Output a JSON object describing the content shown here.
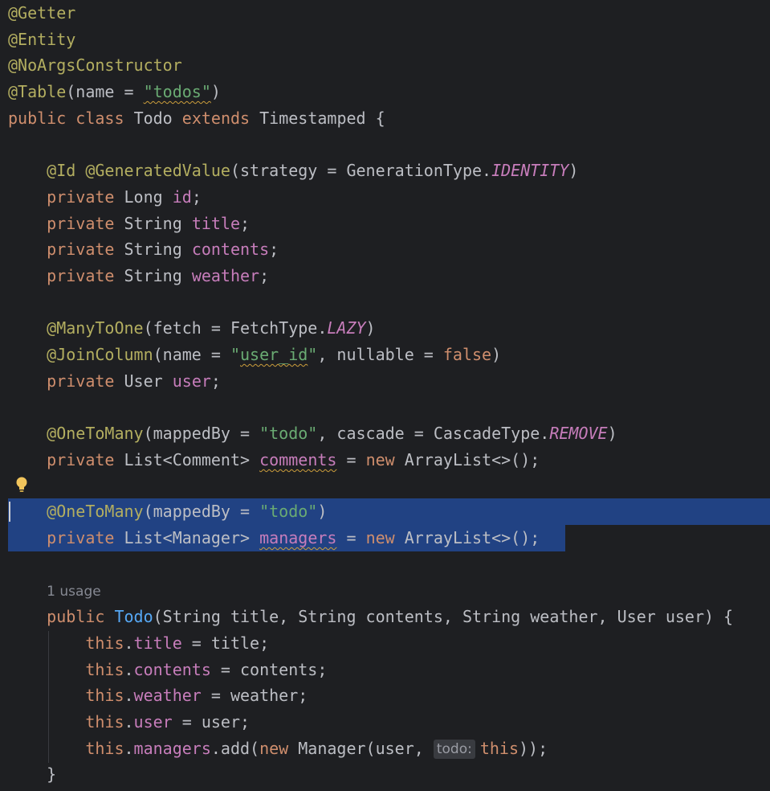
{
  "editor": {
    "file_language": "Java",
    "colors": {
      "background": "#1e1f22",
      "selection": "#214283",
      "keyword": "#cf8e6d",
      "annotation": "#b3ae60",
      "string": "#6aab73",
      "field": "#c77dbb",
      "method_declaration": "#56a8f5",
      "default_text": "#bcbec4",
      "typo_underline": "#cc9e3c"
    },
    "icons": {
      "gutter_hint": "lightbulb-icon"
    },
    "tokens": {
      "getter": "@Getter",
      "entity": "@Entity",
      "noargs": "@NoArgsConstructor",
      "table": "@Table",
      "name_eq": "(name = ",
      "todos_str": "\"todos\"",
      "close_paren": ")",
      "public": "public",
      "class": "class",
      "todo_class": "Todo",
      "extends": "extends",
      "timestamped_brace": "Timestamped {",
      "id_ann": "@Id",
      "generated_ann": "@GeneratedValue",
      "strategy_open": "(strategy = GenerationType.",
      "identity": "IDENTITY",
      "private": "private",
      "long_type": "Long",
      "id_field": "id",
      "semicolon": ";",
      "string_type": "String",
      "title_field": "title",
      "contents_field": "contents",
      "weather_field": "weather",
      "manytoone_ann": "@ManyToOne",
      "fetch_open": "(fetch = FetchType.",
      "lazy": "LAZY",
      "joincolumn_ann": "@JoinColumn",
      "quote": "\"",
      "user_id_text": "user_id",
      "nullable_eq": ", nullable = ",
      "false_kw": "false",
      "user_type": "User",
      "user_field": "user",
      "onetomany_ann": "@OneToMany",
      "mappedby_eq": "(mappedBy = ",
      "todo_str": "\"todo\"",
      "cascade_open": ", cascade = CascadeType.",
      "remove": "REMOVE",
      "list_comment": "List<Comment>",
      "comments_field": "comments",
      "assign": " = ",
      "new_kw": "new",
      "arraylist_end": "ArrayList<>();",
      "list_manager": "List<Manager>",
      "managers_field": "managers",
      "usage_count": "1 usage",
      "constructor_name": "Todo",
      "ctor_params": "(String title, String contents, String weather, User user) {",
      "this_kw": "this",
      "dot": ".",
      "eq_title": " = title;",
      "eq_contents": " = contents;",
      "eq_weather": " = weather;",
      "eq_user": " = user;",
      "add_open": ".add(",
      "manager_call": " Manager(user, ",
      "param_hint": "todo:",
      "close_call": "));",
      "close_brace": "}"
    }
  }
}
